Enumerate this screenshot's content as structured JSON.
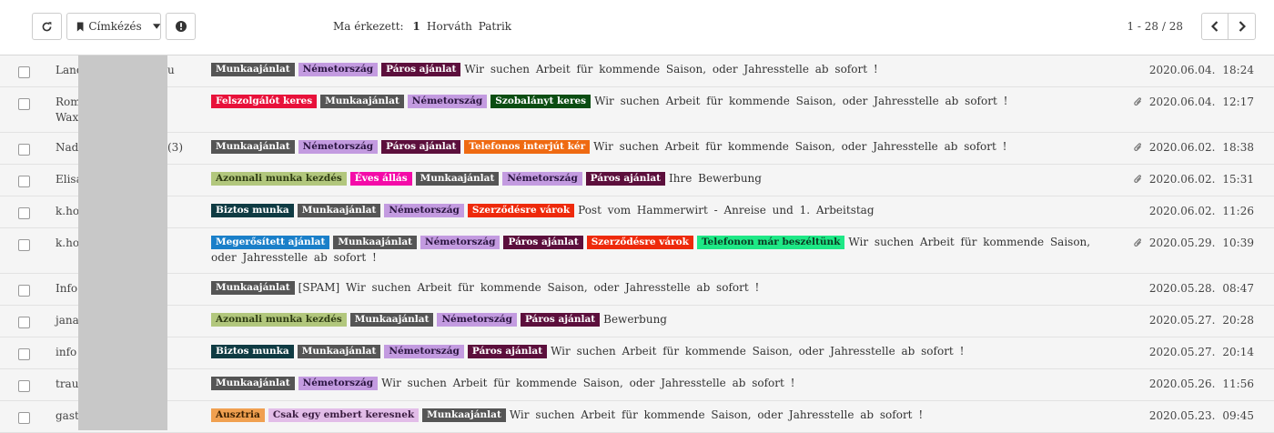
{
  "toolbar": {
    "label_button": "Címkézés",
    "info_label": "Ma érkezett:",
    "info_count": "1",
    "user_name": "Horváth Patrik",
    "pager": "1 - 28 / 28"
  },
  "tag_styles": {
    "Munkaajánlat": {
      "bg": "#555555",
      "fg": "#ffffff"
    },
    "Németország": {
      "bg": "#c39be0",
      "fg": "#2a1540"
    },
    "Páros ajánlat": {
      "bg": "#5c0f3c",
      "fg": "#ffffff"
    },
    "Felszolgálót keres": {
      "bg": "#e8113a",
      "fg": "#ffffff"
    },
    "Szobalányt keres": {
      "bg": "#0b4d12",
      "fg": "#ffffff"
    },
    "Telefonos interjút kér": {
      "bg": "#ef6a12",
      "fg": "#ffffff"
    },
    "Azonnali munka kezdés": {
      "bg": "#b2c77d",
      "fg": "#2d3a12"
    },
    "Éves állás": {
      "bg": "#f40ba8",
      "fg": "#ffffff"
    },
    "Biztos munka": {
      "bg": "#0f3b43",
      "fg": "#ffffff"
    },
    "Szerződésre várok": {
      "bg": "#ee2a0b",
      "fg": "#ffffff"
    },
    "Megerősített ajánlat": {
      "bg": "#1a7fc9",
      "fg": "#ffffff"
    },
    "Telefonon már beszéltünk": {
      "bg": "#1ee886",
      "fg": "#0c3a22"
    },
    "Ausztria": {
      "bg": "#f0a050",
      "fg": "#3a1f00"
    },
    "Csak egy embert keresnek": {
      "bg": "#e2bde8",
      "fg": "#3a1d40"
    }
  },
  "emails": [
    {
      "sender": "Land",
      "sender_extra": "u",
      "tags": [
        "Munkaajánlat",
        "Németország",
        "Páros ajánlat"
      ],
      "subject": "Wir suchen Arbeit für kommende Saison, oder Jahresstelle ab sofort !",
      "attachment": false,
      "date": "2020.06.04.",
      "time": "18:24"
    },
    {
      "sender": "Rom",
      "sender_line2": "Waxe",
      "tags": [
        "Felszolgálót keres",
        "Munkaajánlat",
        "Németország",
        "Szobalányt keres"
      ],
      "subject": "Wir suchen Arbeit für kommende Saison, oder Jahresstelle ab sofort !",
      "attachment": true,
      "date": "2020.06.04.",
      "time": "12:17"
    },
    {
      "sender": "Nadi",
      "sender_extra": "(3)",
      "tags": [
        "Munkaajánlat",
        "Németország",
        "Páros ajánlat",
        "Telefonos interjút kér"
      ],
      "subject": "Wir suchen Arbeit für kommende Saison, oder Jahresstelle ab sofort !",
      "attachment": true,
      "date": "2020.06.02.",
      "time": "18:38"
    },
    {
      "sender": "Elisa",
      "tags": [
        "Azonnali munka kezdés",
        "Éves állás",
        "Munkaajánlat",
        "Németország",
        "Páros ajánlat"
      ],
      "subject": "Ihre Bewerbung",
      "attachment": true,
      "date": "2020.06.02.",
      "time": "15:31"
    },
    {
      "sender": "k.hoe",
      "tags": [
        "Biztos munka",
        "Munkaajánlat",
        "Németország",
        "Szerződésre várok"
      ],
      "subject": "Post vom Hammerwirt - Anreise und 1. Arbeitstag",
      "attachment": false,
      "date": "2020.06.02.",
      "time": "11:26"
    },
    {
      "sender": "k.hoe",
      "tags": [
        "Megerősített ajánlat",
        "Munkaajánlat",
        "Németország",
        "Páros ajánlat",
        "Szerződésre várok",
        "Telefonon már beszéltünk"
      ],
      "subject": "Wir suchen Arbeit für kommende Saison, oder Jahresstelle ab sofort !",
      "attachment": true,
      "date": "2020.05.29.",
      "time": "10:39"
    },
    {
      "sender": "Info",
      "tags": [
        "Munkaajánlat"
      ],
      "subject": "[SPAM] Wir suchen Arbeit für kommende Saison, oder Jahresstelle ab sofort !",
      "attachment": false,
      "date": "2020.05.28.",
      "time": "08:47"
    },
    {
      "sender": "janar",
      "tags": [
        "Azonnali munka kezdés",
        "Munkaajánlat",
        "Németország",
        "Páros ajánlat"
      ],
      "subject": "Bewerbung",
      "attachment": false,
      "date": "2020.05.27.",
      "time": "20:28"
    },
    {
      "sender": "info",
      "tags": [
        "Biztos munka",
        "Munkaajánlat",
        "Németország",
        "Páros ajánlat"
      ],
      "subject": "Wir suchen Arbeit für kommende Saison, oder Jahresstelle ab sofort !",
      "attachment": false,
      "date": "2020.05.27.",
      "time": "20:14"
    },
    {
      "sender": "traub",
      "tags": [
        "Munkaajánlat",
        "Németország"
      ],
      "subject": "Wir suchen Arbeit für kommende Saison, oder Jahresstelle ab sofort !",
      "attachment": false,
      "date": "2020.05.26.",
      "time": "11:56"
    },
    {
      "sender": "gasth",
      "tags": [
        "Ausztria",
        "Csak egy embert keresnek",
        "Munkaajánlat"
      ],
      "subject": "Wir suchen Arbeit für kommende Saison, oder Jahresstelle ab sofort !",
      "attachment": false,
      "date": "2020.05.23.",
      "time": "09:45"
    }
  ]
}
